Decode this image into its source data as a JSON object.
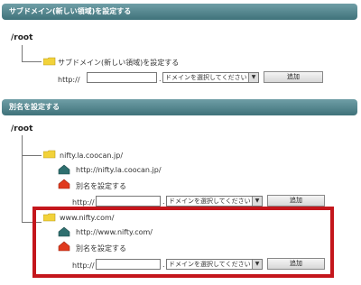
{
  "section1": {
    "title": "サブドメイン(新しい領域)を設定する",
    "root_label": "/root",
    "item_label": "サブドメイン(新しい領域)を設定する",
    "prefix": "http://",
    "dot": ".",
    "input_value": "",
    "select_value": "ドメインを選択してください",
    "add_label": "追加"
  },
  "section2": {
    "title": "別名を設定する",
    "root_label": "/root",
    "entries": [
      {
        "domain": "nifty.la.coocan.jp/",
        "url": "http://nifty.la.coocan.jp/",
        "alias_label": "別名を設定する",
        "prefix": "http://",
        "dot": ".",
        "select_value": "ドメインを選択してください",
        "add_label": "追加"
      },
      {
        "domain": "www.nifty.com/",
        "url": "http://www.nifty.com/",
        "alias_label": "別名を設定する",
        "prefix": "http://",
        "dot": ".",
        "select_value": "ドメインを選択してください",
        "add_label": "追加"
      }
    ]
  },
  "colors": {
    "header_bg": "#4d8088",
    "highlight_border": "#c4161c",
    "folder": "#f2d23a"
  }
}
